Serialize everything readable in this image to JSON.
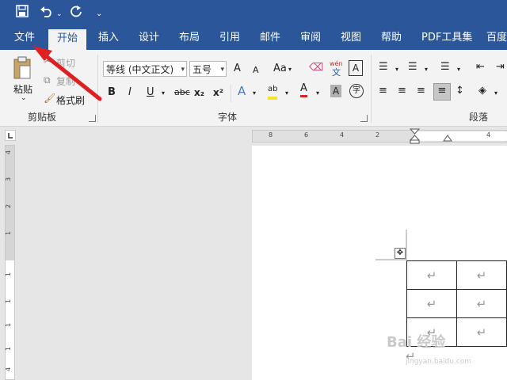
{
  "qat": {
    "save_icon": "save-icon",
    "undo_icon": "undo-icon",
    "redo_icon": "redo-icon",
    "customize_icon": "customize-icon"
  },
  "tabs": [
    "文件",
    "开始",
    "插入",
    "设计",
    "布局",
    "引用",
    "邮件",
    "审阅",
    "视图",
    "帮助",
    "PDF工具集",
    "百度"
  ],
  "active_tab": "开始",
  "clipboard": {
    "paste": "粘贴",
    "cut": "剪切",
    "copy": "复制",
    "format_painter": "格式刷",
    "label": "剪贴板"
  },
  "font": {
    "name": "等线 (中文正文)",
    "size": "五号",
    "grow": "A",
    "shrink": "A",
    "case": "Aa",
    "wen": "wén",
    "wen_char": "文",
    "border_char": "A",
    "bold": "B",
    "italic": "I",
    "underline": "U",
    "strike": "abc",
    "sub": "x₂",
    "sup": "x²",
    "effects": "A",
    "highlight": "ab",
    "color": "A",
    "shade": "A",
    "enclose": "字",
    "label": "字体"
  },
  "paragraph": {
    "label": "段落"
  },
  "hruler": [
    "8",
    "6",
    "4",
    "2",
    "4"
  ],
  "vruler": [
    "4",
    "3",
    "2",
    "1",
    "1",
    "1",
    "1",
    "1",
    "4"
  ],
  "table": {
    "cell_mark": "↵",
    "para_mark": "↵"
  },
  "watermark": {
    "main": "Bai 经验",
    "sub": "jingyan.baidu.com"
  },
  "colors": {
    "accent": "#2b579a",
    "arrow": "#e02020"
  }
}
